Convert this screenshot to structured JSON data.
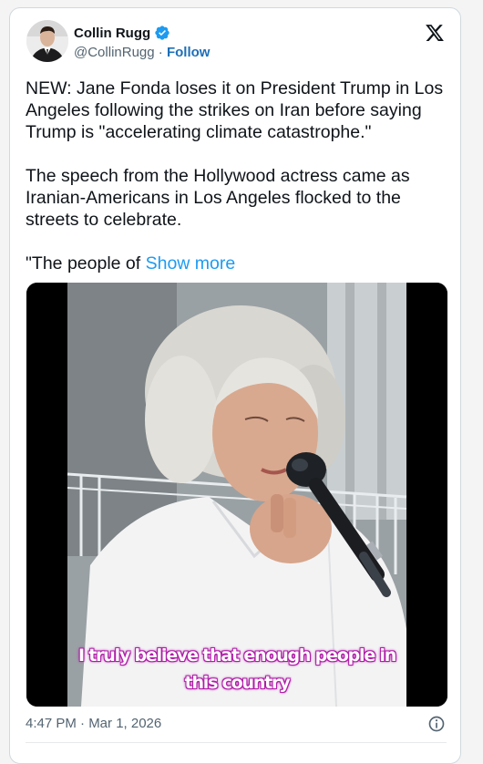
{
  "author": {
    "name": "Collin Rugg",
    "handle": "@CollinRugg",
    "separator": "·",
    "follow_label": "Follow"
  },
  "tweet": {
    "paragraphs": [
      "NEW: Jane Fonda loses it on President Trump in Los Angeles following the strikes on Iran before saying Trump is \"accelerating climate catastrophe.\"",
      "The speech from the Hollywood actress came as Iranian-Americans in Los Angeles flocked to the streets to celebrate."
    ],
    "truncated_text": "\"The people of",
    "show_more_label": "Show more"
  },
  "video": {
    "caption_line1": "I truly believe that enough people in",
    "caption_line2": "this country"
  },
  "footer": {
    "timestamp": "4:47 PM · Mar 1, 2026"
  },
  "colors": {
    "link": "#1d9bf0",
    "follow": "#1d6fb8",
    "verified": "#1d9bf0",
    "caption_outline": "#b01ea8"
  },
  "icons": {
    "verified": "verified-badge-icon",
    "platform": "x-logo-icon",
    "info": "info-icon"
  }
}
